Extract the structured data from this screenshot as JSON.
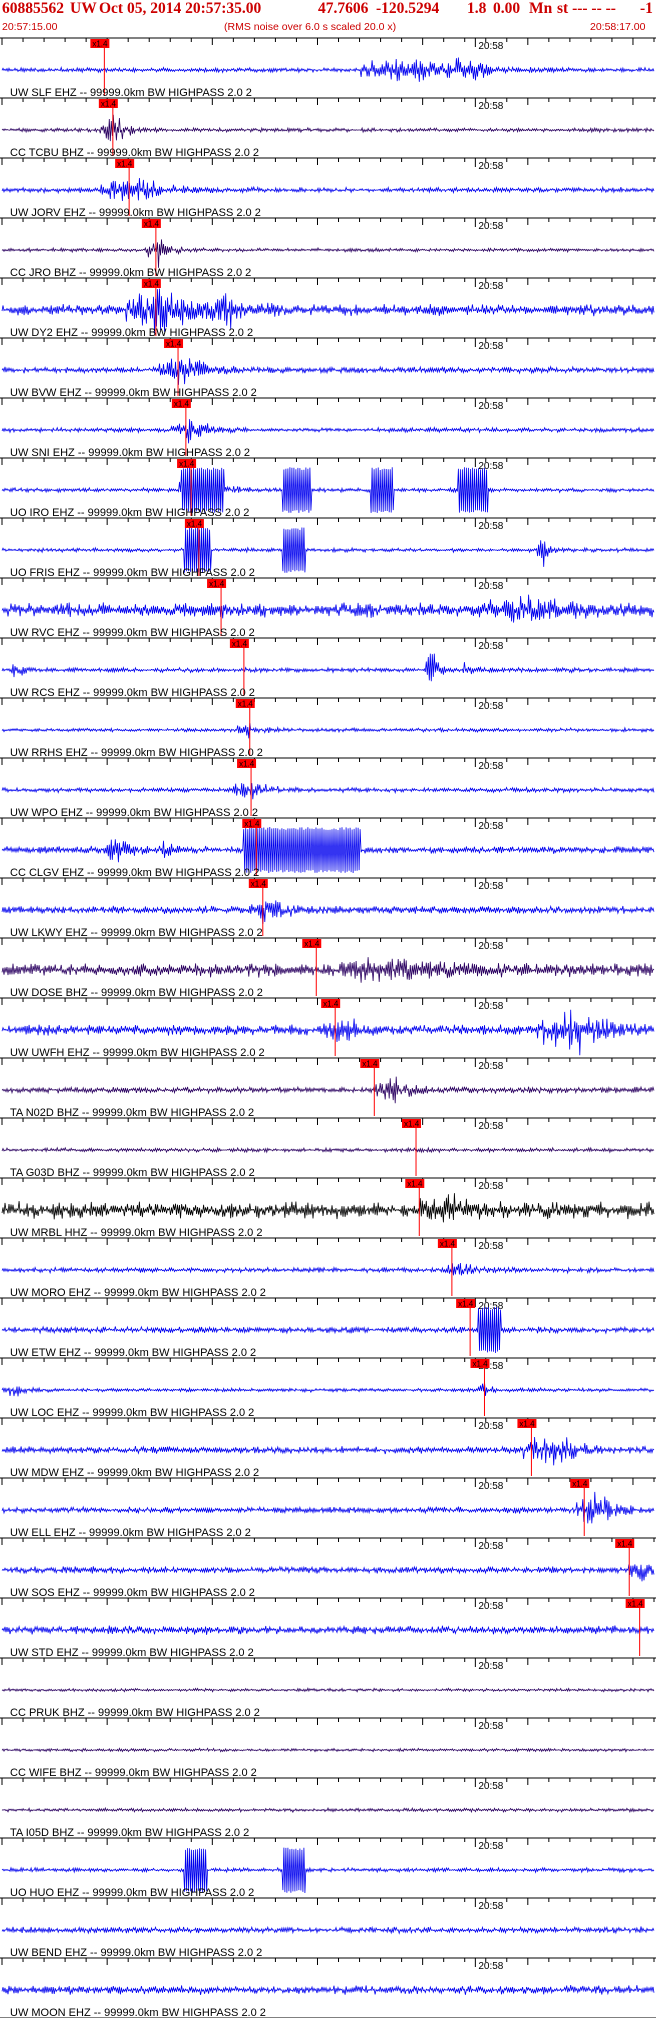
{
  "header": {
    "event_id": "60885562",
    "network": "UW",
    "datetime": "Oct 05, 2014 20:57:35.00",
    "lat": "47.7606",
    "lon": "-120.5294",
    "depth": "1.8",
    "mag": "0.00",
    "mag_type": "Mn",
    "status": "st --- -- --",
    "flag": "-1",
    "start_time": "20:57:15.00",
    "end_time": "20:58:17.00",
    "note": "(RMS noise over 6.0 s scaled 20.0 x)"
  },
  "minute_mark": "20:58",
  "pick_label": "x1.4",
  "colors": {
    "trace_blue": "#0000ee",
    "trace_purple": "#2a0060",
    "trace_black": "#000000",
    "pick": "#ff0000",
    "axis": "#000000",
    "title": "#cc0000"
  },
  "traces": [
    {
      "label": "UW SLF EHZ -- 99999.0km BW  HIGHPASS  2.0  2",
      "color": "blue",
      "noise": 0.9,
      "pick": 0.157,
      "evt": [
        [
          0.62,
          0.07,
          14
        ],
        [
          0.71,
          0.04,
          9
        ]
      ]
    },
    {
      "label": "CC TCBU BHZ -- 99999.0km BW  HIGHPASS  2.0  2",
      "color": "purple",
      "noise": 0.8,
      "pick": 0.17,
      "evt": [
        [
          0.17,
          0.02,
          16
        ]
      ]
    },
    {
      "label": "UW JORV EHZ -- 99999.0km BW  HIGHPASS  2.0  2",
      "color": "blue",
      "noise": 1.0,
      "pick": 0.195,
      "evt": [
        [
          0.2,
          0.05,
          12
        ]
      ]
    },
    {
      "label": "CC JRO BHZ -- 99999.0km BW  HIGHPASS  2.0  2",
      "color": "purple",
      "noise": 0.7,
      "pick": 0.236,
      "evt": [
        [
          0.24,
          0.02,
          14
        ]
      ]
    },
    {
      "label": "UW DY2 EHZ -- 99999.0km BW  HIGHPASS  2.0  2",
      "color": "blue",
      "noise": 2.2,
      "pick": 0.236,
      "evt": [
        [
          0.24,
          0.05,
          20
        ],
        [
          0.35,
          0.04,
          12
        ]
      ]
    },
    {
      "label": "UW BVW EHZ -- 99999.0km BW  HIGHPASS  2.0  2",
      "color": "blue",
      "noise": 1.2,
      "pick": 0.27,
      "evt": [
        [
          0.28,
          0.04,
          16
        ]
      ]
    },
    {
      "label": "UW SNI EHZ -- 99999.0km BW  HIGHPASS  2.0  2",
      "color": "blue",
      "noise": 0.9,
      "pick": 0.282,
      "evt": [
        [
          0.29,
          0.03,
          10
        ]
      ]
    },
    {
      "label": "UO IRO EHZ -- 99999.0km BW  HIGHPASS  2.0  2",
      "color": "blue",
      "noise": 0.8,
      "pick": 0.29,
      "evt": [
        [
          0.3,
          0.03,
          22
        ]
      ],
      "clip": [
        [
          0.275,
          0.34
        ],
        [
          0.43,
          0.475
        ],
        [
          0.565,
          0.6
        ],
        [
          0.7,
          0.745
        ]
      ]
    },
    {
      "label": "UO FRIS EHZ -- 99999.0km BW  HIGHPASS  2.0  2",
      "color": "blue",
      "noise": 0.8,
      "pick": 0.302,
      "evt": [
        [
          0.83,
          0.01,
          16
        ]
      ],
      "clip": [
        [
          0.28,
          0.32
        ],
        [
          0.43,
          0.465
        ]
      ]
    },
    {
      "label": "UW RVC EHZ -- 99999.0km BW  HIGHPASS  2.0  2",
      "color": "blue",
      "noise": 2.8,
      "pick": 0.336,
      "evt": [
        [
          0.8,
          0.06,
          10
        ]
      ]
    },
    {
      "label": "UW RCS EHZ -- 99999.0km BW  HIGHPASS  2.0  2",
      "color": "blue",
      "noise": 0.9,
      "pick": 0.371,
      "evt": [
        [
          0.02,
          0.01,
          9
        ],
        [
          0.66,
          0.01,
          18
        ],
        [
          0.71,
          0.01,
          8
        ]
      ]
    },
    {
      "label": "UW RRHS EHZ -- 99999.0km BW  HIGHPASS  2.0  2",
      "color": "blue",
      "noise": 0.7,
      "pick": 0.38,
      "evt": [
        [
          0.38,
          0.02,
          9
        ]
      ]
    },
    {
      "label": "UW WPO EHZ -- 99999.0km BW  HIGHPASS  2.0  2",
      "color": "blue",
      "noise": 0.9,
      "pick": 0.382,
      "evt": [
        [
          0.38,
          0.03,
          10
        ]
      ]
    },
    {
      "label": "CC CLGV EHZ -- 99999.0km BW  HIGHPASS  2.0  2",
      "color": "blue",
      "noise": 1.4,
      "pick": 0.39,
      "evt": [
        [
          0.18,
          0.02,
          12
        ],
        [
          0.25,
          0.01,
          10
        ]
      ],
      "clip": [
        [
          0.37,
          0.55
        ]
      ]
    },
    {
      "label": "UW LKWY EHZ -- 99999.0km BW  HIGHPASS  2.0  2",
      "color": "blue",
      "noise": 1.5,
      "pick": 0.4,
      "evt": [
        [
          0.41,
          0.03,
          14
        ]
      ]
    },
    {
      "label": "UW DOSE BHZ -- 99999.0km BW  HIGHPASS  2.0  2",
      "color": "purple",
      "noise": 2.6,
      "pick": 0.482,
      "evt": [
        [
          0.6,
          0.08,
          10
        ]
      ]
    },
    {
      "label": "UW UWFH EHZ -- 99999.0km BW  HIGHPASS  2.0  2",
      "color": "blue",
      "noise": 2.0,
      "pick": 0.511,
      "evt": [
        [
          0.52,
          0.03,
          12
        ],
        [
          0.88,
          0.06,
          20
        ]
      ]
    },
    {
      "label": "TA N02D BHZ -- 99999.0km BW  HIGHPASS  2.0  2",
      "color": "purple",
      "noise": 1.2,
      "pick": 0.571,
      "evt": [
        [
          0.6,
          0.03,
          12
        ]
      ]
    },
    {
      "label": "TA G03D BHZ -- 99999.0km BW  HIGHPASS  2.0  2",
      "color": "purple",
      "noise": 0.8,
      "pick": 0.635,
      "evt": []
    },
    {
      "label": "UW MRBL HHZ -- 99999.0km BW  HIGHPASS  2.0  2",
      "color": "black",
      "noise": 3.2,
      "pick": 0.64,
      "evt": [
        [
          0.68,
          0.04,
          10
        ]
      ]
    },
    {
      "label": "UW MORO EHZ -- 99999.0km BW  HIGHPASS  2.0  2",
      "color": "blue",
      "noise": 1.0,
      "pick": 0.69,
      "evt": [
        [
          0.7,
          0.02,
          8
        ]
      ]
    },
    {
      "label": "UW ETW EHZ -- 99999.0km BW  HIGHPASS  2.0  2",
      "color": "blue",
      "noise": 1.2,
      "pick": 0.718,
      "evt": [],
      "clip": [
        [
          0.73,
          0.765
        ]
      ]
    },
    {
      "label": "UW LOC EHZ -- 99999.0km BW  HIGHPASS  2.0  2",
      "color": "blue",
      "noise": 0.7,
      "pick": 0.74,
      "evt": [
        [
          0.02,
          0.02,
          8
        ],
        [
          0.74,
          0.01,
          9
        ]
      ]
    },
    {
      "label": "UW MDW EHZ -- 99999.0km BW  HIGHPASS  2.0  2",
      "color": "blue",
      "noise": 1.4,
      "pick": 0.812,
      "evt": [
        [
          0.84,
          0.04,
          20
        ]
      ]
    },
    {
      "label": "UW ELL EHZ -- 99999.0km BW  HIGHPASS  2.0  2",
      "color": "blue",
      "noise": 1.2,
      "pick": 0.893,
      "evt": [
        [
          0.91,
          0.03,
          16
        ]
      ]
    },
    {
      "label": "UW SOS EHZ -- 99999.0km BW  HIGHPASS  2.0  2",
      "color": "blue",
      "noise": 1.3,
      "pick": 0.962,
      "evt": [
        [
          0.98,
          0.02,
          10
        ]
      ]
    },
    {
      "label": "UW STD EHZ -- 99999.0km BW  HIGHPASS  2.0  2",
      "color": "blue",
      "noise": 1.6,
      "pick": 0.978,
      "evt": []
    },
    {
      "label": "CC PRUK BHZ -- 99999.0km BW  HIGHPASS  2.0  2",
      "color": "purple",
      "noise": 0.6,
      "pick": null,
      "evt": []
    },
    {
      "label": "CC WIFE BHZ -- 99999.0km BW  HIGHPASS  2.0  2",
      "color": "purple",
      "noise": 0.6,
      "pick": null,
      "evt": []
    },
    {
      "label": "TA I05D BHZ -- 99999.0km BW  HIGHPASS  2.0  2",
      "color": "purple",
      "noise": 0.7,
      "pick": null,
      "evt": []
    },
    {
      "label": "UO HUO EHZ -- 99999.0km BW  HIGHPASS  2.0  2",
      "color": "blue",
      "noise": 0.8,
      "pick": null,
      "evt": [],
      "clip": [
        [
          0.28,
          0.315
        ],
        [
          0.43,
          0.465
        ]
      ]
    },
    {
      "label": "UW BEND EHZ -- 99999.0km BW  HIGHPASS  2.0  2",
      "color": "blue",
      "noise": 1.2,
      "pick": null,
      "evt": []
    },
    {
      "label": "UW MOON EHZ -- 99999.0km BW  HIGHPASS  2.0  2",
      "color": "blue",
      "noise": 1.7,
      "pick": null,
      "evt": []
    }
  ]
}
